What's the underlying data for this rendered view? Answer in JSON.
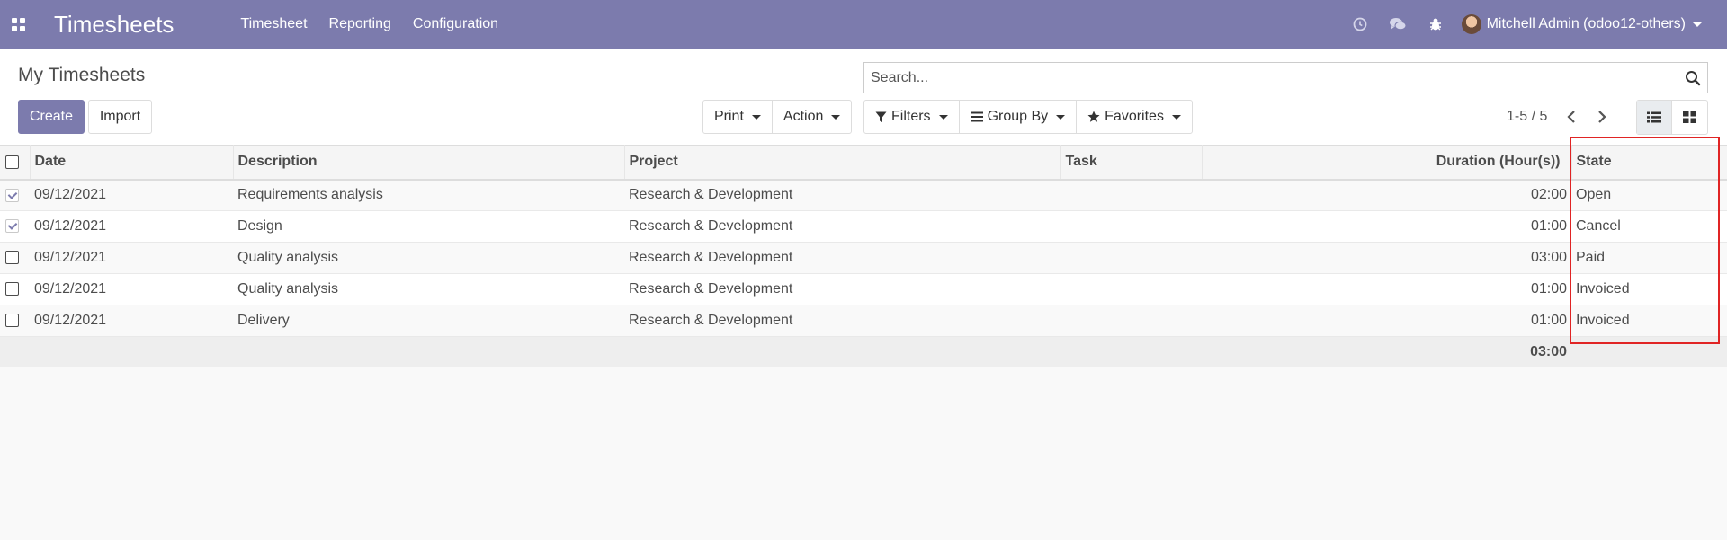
{
  "navbar": {
    "app_title": "Timesheets",
    "menu": [
      "Timesheet",
      "Reporting",
      "Configuration"
    ],
    "user_name": "Mitchell Admin (odoo12-others)"
  },
  "control_panel": {
    "breadcrumb": "My Timesheets",
    "search_placeholder": "Search...",
    "create_label": "Create",
    "import_label": "Import",
    "print_label": "Print",
    "action_label": "Action",
    "filters_label": "Filters",
    "groupby_label": "Group By",
    "favorites_label": "Favorites",
    "pager_value": "1-5 / 5"
  },
  "table": {
    "columns": [
      "Date",
      "Description",
      "Project",
      "Task",
      "Duration (Hour(s))",
      "State"
    ],
    "rows": [
      {
        "checked": true,
        "date": "09/12/2021",
        "description": "Requirements analysis",
        "project": "Research & Development",
        "task": "",
        "duration": "02:00",
        "state": "Open"
      },
      {
        "checked": true,
        "date": "09/12/2021",
        "description": "Design",
        "project": "Research & Development",
        "task": "",
        "duration": "01:00",
        "state": "Cancel"
      },
      {
        "checked": false,
        "date": "09/12/2021",
        "description": "Quality analysis",
        "project": "Research & Development",
        "task": "",
        "duration": "03:00",
        "state": "Paid"
      },
      {
        "checked": false,
        "date": "09/12/2021",
        "description": "Quality analysis",
        "project": "Research & Development",
        "task": "",
        "duration": "01:00",
        "state": "Invoiced"
      },
      {
        "checked": false,
        "date": "09/12/2021",
        "description": "Delivery",
        "project": "Research & Development",
        "task": "",
        "duration": "01:00",
        "state": "Invoiced"
      }
    ],
    "footer_total": "03:00"
  },
  "colors": {
    "navbar": "#7c7bad",
    "primary_button": "#7c7bad",
    "highlight": "#e02424"
  }
}
